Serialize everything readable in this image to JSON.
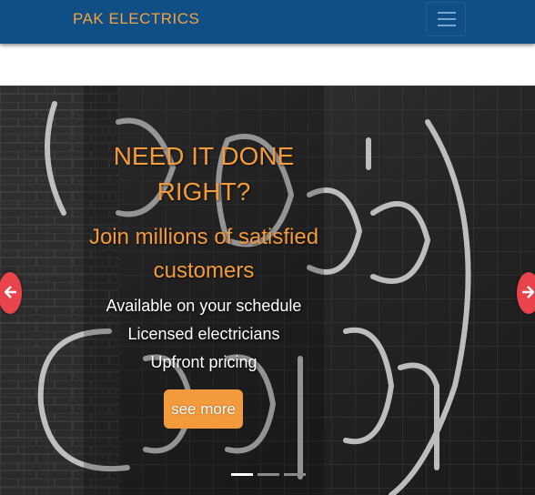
{
  "navbar": {
    "brand": "PAK ELECTRICS",
    "toggler_icon": "hamburger-menu-icon"
  },
  "hero": {
    "headline": "NEED IT DONE RIGHT?",
    "subline": "Join millions of satisfied customers",
    "features": [
      "Available on your schedule",
      "Licensed electricians",
      "Upfront pricing"
    ],
    "cta_label": "see more",
    "prev_icon": "arrow-left-icon",
    "next_icon": "arrow-right-icon",
    "slide_count": 3,
    "active_slide": 1
  },
  "colors": {
    "navbar_bg": "#0f4f86",
    "brand": "#f6a13e",
    "accent_orange": "#f39a3c",
    "arrow_red": "#e9434b"
  }
}
